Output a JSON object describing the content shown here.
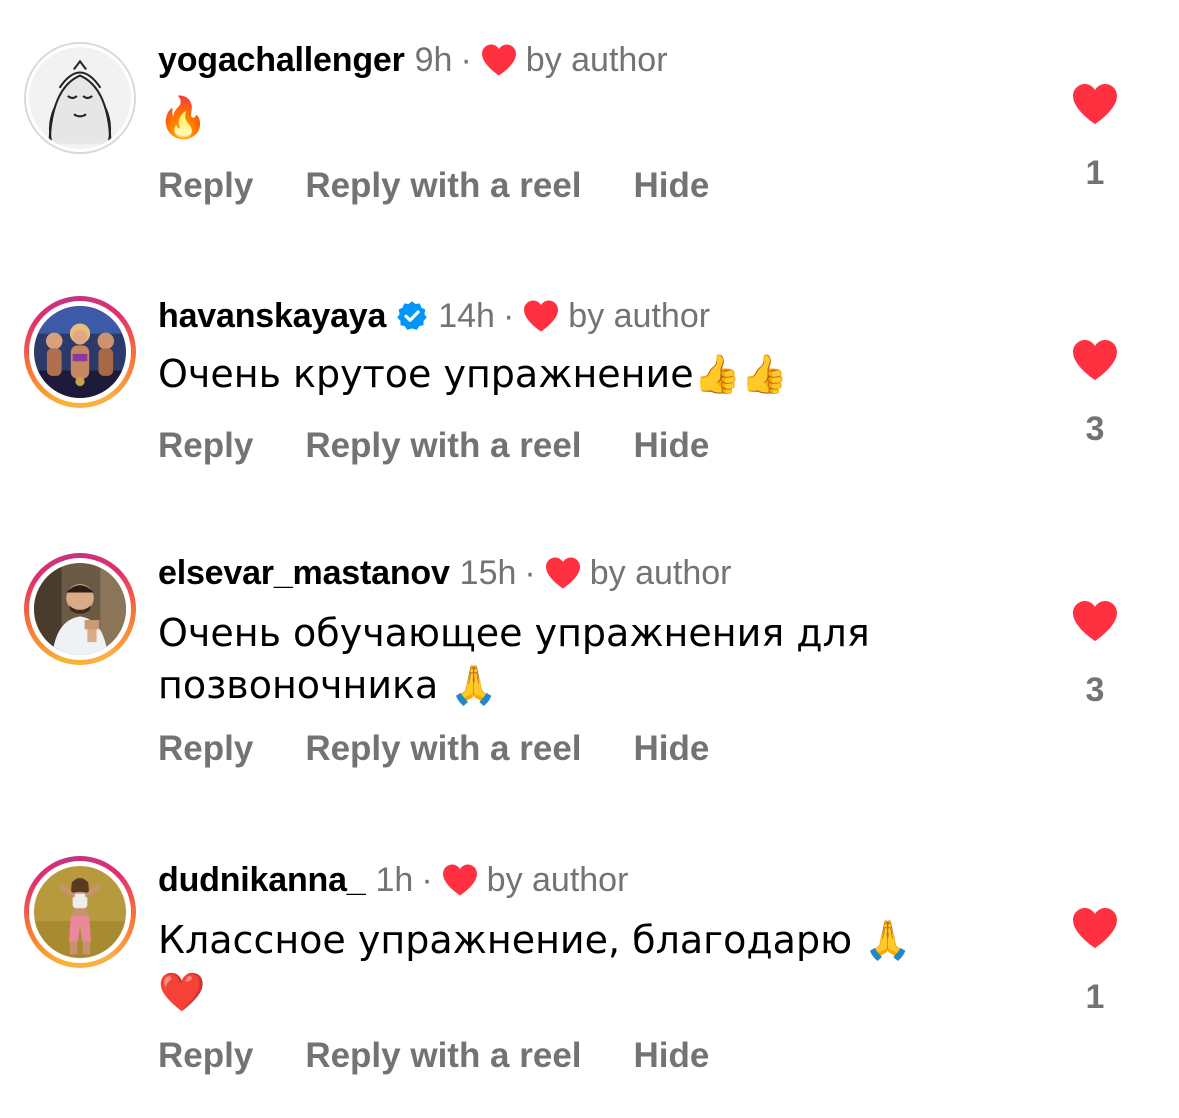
{
  "comments": [
    {
      "username": "yogachallenger",
      "verified": false,
      "time": "9h",
      "dot": "·",
      "by_author": "by author",
      "text": "🔥",
      "actions": {
        "reply": "Reply",
        "reply_reel": "Reply with a reel",
        "hide": "Hide"
      },
      "like_count": "1"
    },
    {
      "username": "havanskayaya",
      "verified": true,
      "time": "14h",
      "dot": "·",
      "by_author": "by author",
      "text": "Очень крутое упражнение👍👍",
      "actions": {
        "reply": "Reply",
        "reply_reel": "Reply with a reel",
        "hide": "Hide"
      },
      "like_count": "3"
    },
    {
      "username": "elsevar_mastanov",
      "verified": false,
      "time": "15h",
      "dot": "·",
      "by_author": "by author",
      "text": "Очень обучающее упражнения для позвоночника 🙏",
      "actions": {
        "reply": "Reply",
        "reply_reel": "Reply with a reel",
        "hide": "Hide"
      },
      "like_count": "3"
    },
    {
      "username": "dudnikanna_",
      "verified": false,
      "time": "1h",
      "dot": "·",
      "by_author": "by author",
      "text": "Классное упражнение, благодарю 🙏 ❤️",
      "actions": {
        "reply": "Reply",
        "reply_reel": "Reply with a reel",
        "hide": "Hide"
      },
      "like_count": "1"
    }
  ],
  "colors": {
    "like_red": "#ff3040",
    "meta_gray": "#737373",
    "verified_blue": "#0095f6"
  },
  "icons": {
    "like": "heart-icon",
    "verified": "verified-badge-icon"
  }
}
